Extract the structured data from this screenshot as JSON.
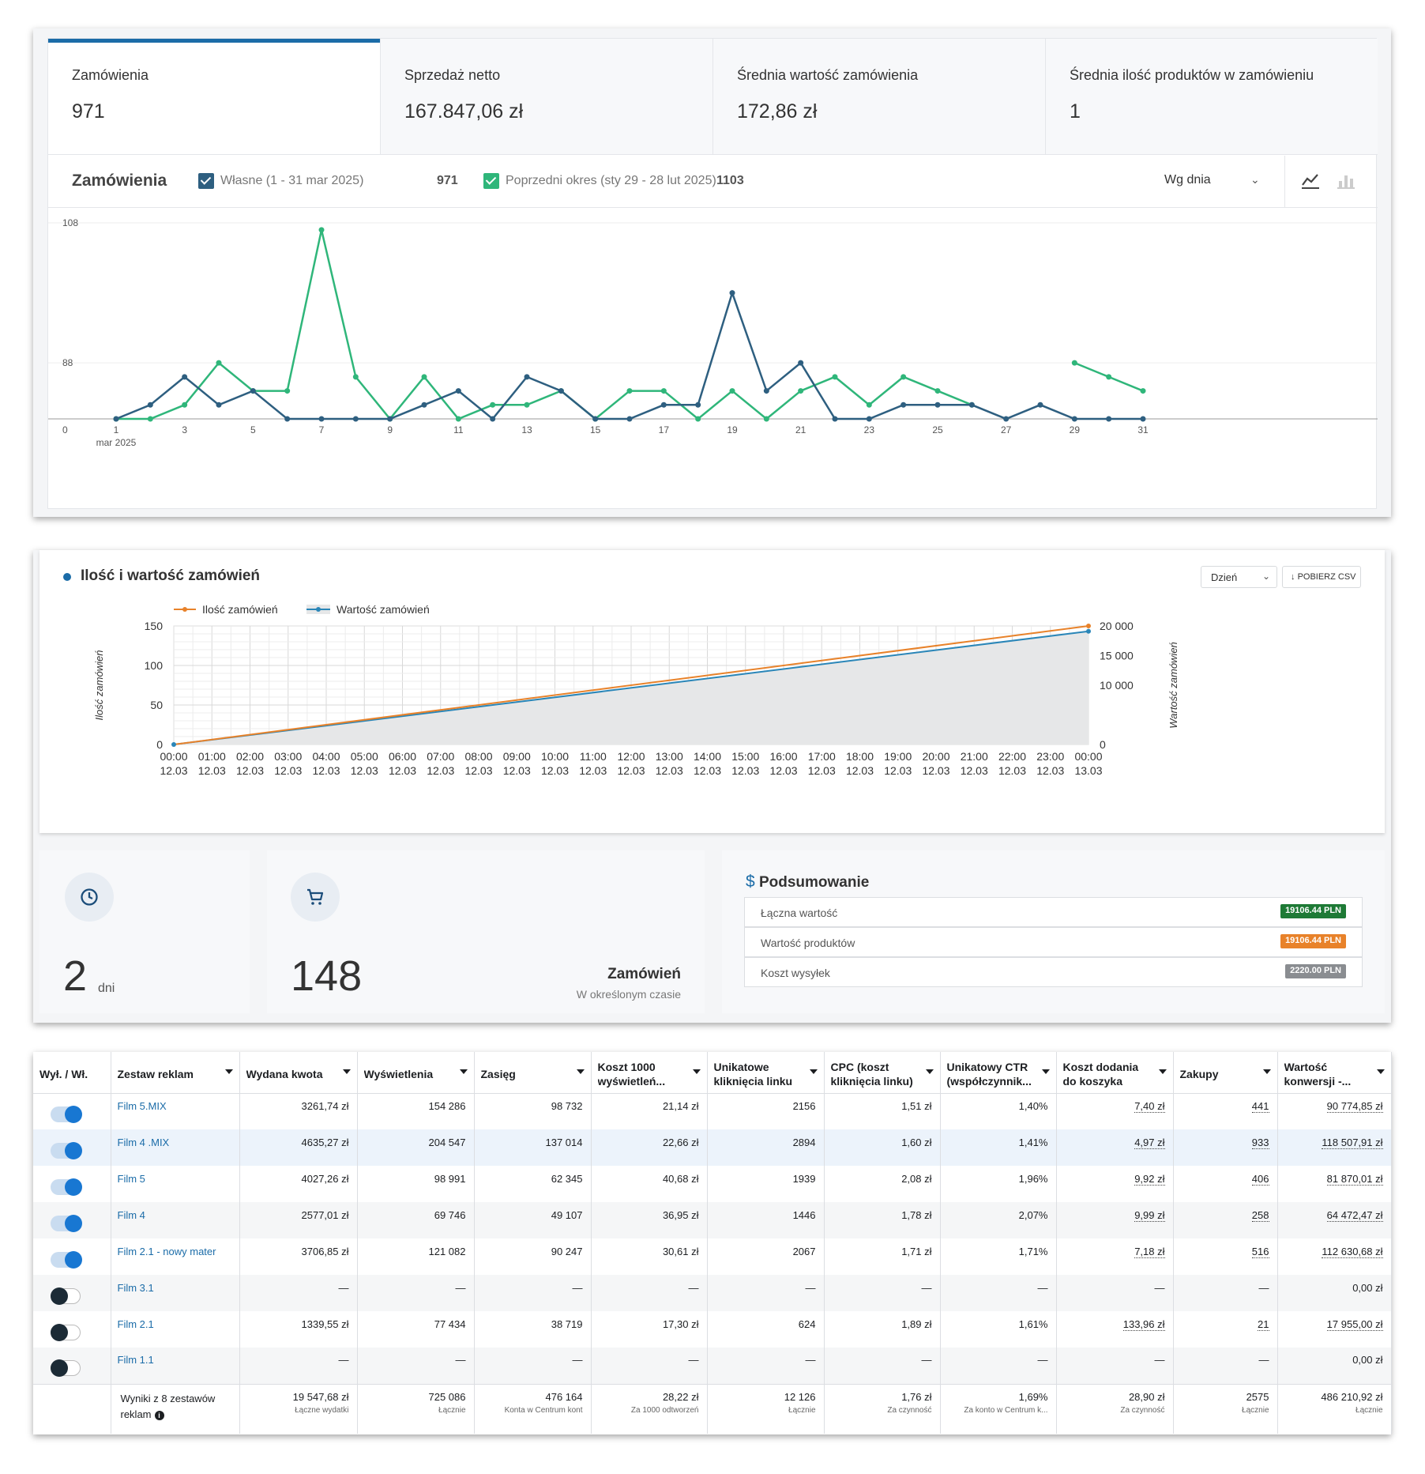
{
  "orders_panel": {
    "kpis": [
      {
        "label": "Zamówienia",
        "value": "971"
      },
      {
        "label": "Sprzedaż netto",
        "value": "167.847,06 zł"
      },
      {
        "label": "Średnia wartość zamówienia",
        "value": "172,86 zł"
      },
      {
        "label": "Średnia ilość produktów w zamówieniu",
        "value": "1"
      }
    ],
    "legend": {
      "title": "Zamówienia",
      "own_label": "Własne (1 - 31 mar 2025)",
      "own_total": "971",
      "prev_label": "Poprzedni okres (sty 29 - 28 lut 2025)",
      "prev_total": "1103",
      "period_select": "Wg dnia",
      "line_icon": "line-chart-icon",
      "bar_icon": "bar-chart-icon"
    },
    "colors": {
      "own": "#2e5f80",
      "prev": "#2fb67a",
      "active_tab": "#1b6ca8"
    }
  },
  "chart_data": [
    {
      "type": "line",
      "x": [
        1,
        2,
        3,
        4,
        5,
        6,
        7,
        8,
        9,
        10,
        11,
        12,
        13,
        14,
        15,
        16,
        17,
        18,
        19,
        20,
        21,
        22,
        23,
        24,
        25,
        26,
        27,
        28,
        29,
        30,
        31
      ],
      "x_tick_labels": [
        "1",
        "3",
        "5",
        "7",
        "9",
        "11",
        "13",
        "15",
        "17",
        "19",
        "21",
        "23",
        "25",
        "27",
        "29",
        "31"
      ],
      "x_sublabel": "mar 2025",
      "y_tick_labels": [
        "0",
        "88",
        "108"
      ],
      "ylim": [
        0,
        110
      ],
      "series": [
        {
          "name": "Własne (1 - 31 mar 2025)",
          "color": "#2e5f80",
          "values": [
            80,
            82,
            86,
            82,
            84,
            80,
            80,
            80,
            80,
            82,
            84,
            80,
            86,
            84,
            80,
            80,
            82,
            82,
            98,
            84,
            88,
            80,
            80,
            82,
            82,
            82,
            80,
            82,
            80,
            80,
            80
          ]
        },
        {
          "name": "Poprzedni okres (sty 29 - 28 lut 2025)",
          "color": "#2fb67a",
          "values": [
            80,
            80,
            82,
            88,
            84,
            84,
            107,
            86,
            80,
            86,
            80,
            82,
            82,
            84,
            80,
            84,
            84,
            80,
            84,
            80,
            84,
            86,
            82,
            86,
            84,
            82,
            null,
            null,
            88,
            86,
            84
          ]
        }
      ]
    },
    {
      "type": "line",
      "title": "Ilość i wartość zamówień",
      "ylabel": "Ilość zamówień",
      "y2label": "Wartość zamówień",
      "ylim": [
        0,
        150
      ],
      "y2lim": [
        0,
        20000
      ],
      "y_ticks": [
        "0",
        "50",
        "100",
        "150"
      ],
      "y2_ticks": [
        "0",
        "10 000",
        "15 000",
        "20 000"
      ],
      "x_labels": [
        [
          "00:00",
          "12.03"
        ],
        [
          "01:00",
          "12.03"
        ],
        [
          "02:00",
          "12.03"
        ],
        [
          "03:00",
          "12.03"
        ],
        [
          "04:00",
          "12.03"
        ],
        [
          "05:00",
          "12.03"
        ],
        [
          "06:00",
          "12.03"
        ],
        [
          "07:00",
          "12.03"
        ],
        [
          "08:00",
          "12.03"
        ],
        [
          "09:00",
          "12.03"
        ],
        [
          "10:00",
          "12.03"
        ],
        [
          "11:00",
          "12.03"
        ],
        [
          "12:00",
          "12.03"
        ],
        [
          "13:00",
          "12.03"
        ],
        [
          "14:00",
          "12.03"
        ],
        [
          "15:00",
          "12.03"
        ],
        [
          "16:00",
          "12.03"
        ],
        [
          "17:00",
          "12.03"
        ],
        [
          "18:00",
          "12.03"
        ],
        [
          "19:00",
          "12.03"
        ],
        [
          "20:00",
          "12.03"
        ],
        [
          "21:00",
          "12.03"
        ],
        [
          "22:00",
          "12.03"
        ],
        [
          "23:00",
          "12.03"
        ],
        [
          "00:00",
          "13.03"
        ]
      ],
      "series": [
        {
          "name": "Ilość zamówień",
          "color": "#e8822a",
          "axis": "left",
          "start": 0,
          "end": 150
        },
        {
          "name": "Wartość zamówień",
          "color": "#2a86b8",
          "axis": "right",
          "start": 0,
          "end": 19106.44
        }
      ]
    }
  ],
  "summary_panel": {
    "select": "Dzień",
    "csv_button": "POBIERZ CSV",
    "days_value": "2",
    "days_unit": "dni",
    "orders_value": "148",
    "orders_title": "Zamówień",
    "orders_sub": "W określonym czasie",
    "summary_title": "Podsumowanie",
    "rows": [
      {
        "label": "Łączna wartość",
        "badge": "19106.44 PLN",
        "color": "#1e7a36"
      },
      {
        "label": "Wartość produktów",
        "badge": "19106.44 PLN",
        "color": "#e8822a"
      },
      {
        "label": "Koszt wysyłek",
        "badge": "2220.00 PLN",
        "color": "#8a8d91"
      }
    ]
  },
  "ads_table": {
    "headers": [
      "Wył. / Wł.",
      "Zestaw reklam",
      "Wydana kwota",
      "Wyświetlenia",
      "Zasięg",
      "Koszt 1000 wyświetleń...",
      "Unikatowe kliknięcia linku",
      "CPC (koszt kliknięcia linku)",
      "Unikatowy CTR (współczynnik...",
      "Koszt dodania do koszyka",
      "Zakupy",
      "Wartość konwersji -..."
    ],
    "rows": [
      {
        "on": true,
        "name": "Film 5.MIX",
        "cells": [
          "3261,74 zł",
          "154 286",
          "98 732",
          "21,14 zł",
          "2156",
          "1,51 zł",
          "1,40%",
          "7,40 zł",
          "441",
          "90 774,85 zł"
        ]
      },
      {
        "on": true,
        "name": "Film 4 .MIX",
        "cells": [
          "4635,27 zł",
          "204 547",
          "137 014",
          "22,66 zł",
          "2894",
          "1,60 zł",
          "1,41%",
          "4,97 zł",
          "933",
          "118 507,91 zł"
        ]
      },
      {
        "on": true,
        "name": "Film 5",
        "cells": [
          "4027,26 zł",
          "98 991",
          "62 345",
          "40,68 zł",
          "1939",
          "2,08 zł",
          "1,96%",
          "9,92 zł",
          "406",
          "81 870,01 zł"
        ]
      },
      {
        "on": true,
        "name": "Film 4",
        "cells": [
          "2577,01 zł",
          "69 746",
          "49 107",
          "36,95 zł",
          "1446",
          "1,78 zł",
          "2,07%",
          "9,99 zł",
          "258",
          "64 472,47 zł"
        ]
      },
      {
        "on": true,
        "name": "Film 2.1 - nowy mater",
        "cells": [
          "3706,85 zł",
          "121 082",
          "90 247",
          "30,61 zł",
          "2067",
          "1,71 zł",
          "1,71%",
          "7,18 zł",
          "516",
          "112 630,68 zł"
        ]
      },
      {
        "on": false,
        "name": "Film 3.1",
        "cells": [
          "—",
          "—",
          "—",
          "—",
          "—",
          "—",
          "—",
          "—",
          "—",
          "0,00 zł"
        ]
      },
      {
        "on": false,
        "name": "Film 2.1",
        "cells": [
          "1339,55 zł",
          "77 434",
          "38 719",
          "17,30 zł",
          "624",
          "1,89 zł",
          "1,61%",
          "133,96 zł",
          "21",
          "17 955,00 zł"
        ]
      },
      {
        "on": false,
        "name": "Film 1.1",
        "cells": [
          "—",
          "—",
          "—",
          "—",
          "—",
          "—",
          "—",
          "—",
          "—",
          "0,00 zł"
        ]
      }
    ],
    "footer_label": "Wyniki z 8 zestawów reklam",
    "footer": [
      {
        "v": "19 547,68 zł",
        "s": "Łączne wydatki"
      },
      {
        "v": "725 086",
        "s": "Łącznie"
      },
      {
        "v": "476 164",
        "s": "Konta w Centrum kont"
      },
      {
        "v": "28,22 zł",
        "s": "Za 1000 odtworzeń"
      },
      {
        "v": "12 126",
        "s": "Łącznie"
      },
      {
        "v": "1,76 zł",
        "s": "Za czynność"
      },
      {
        "v": "1,69%",
        "s": "Za konto w Centrum k..."
      },
      {
        "v": "28,90 zł",
        "s": "Za czynność"
      },
      {
        "v": "2575",
        "s": "Łącznie"
      },
      {
        "v": "486 210,92 zł",
        "s": "Łącznie"
      }
    ]
  }
}
